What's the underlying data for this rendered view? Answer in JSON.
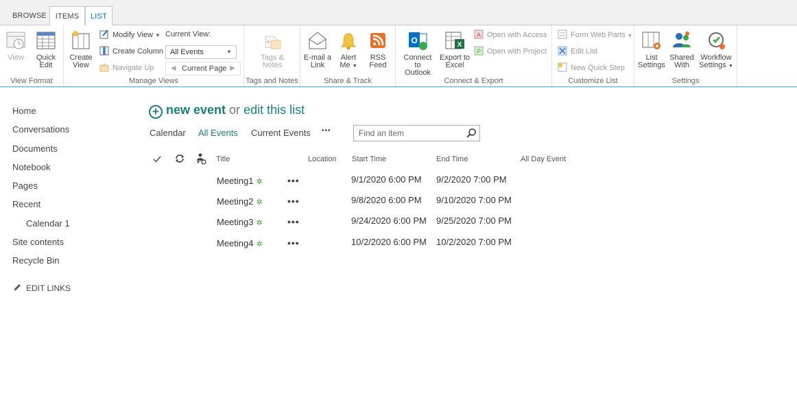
{
  "tabs": {
    "browse": "BROWSE",
    "items": "ITEMS",
    "list": "LIST"
  },
  "ribbon": {
    "view_format": {
      "label": "View Format",
      "view": "View",
      "quick_edit": [
        "Quick",
        "Edit"
      ]
    },
    "manage_views": {
      "label": "Manage Views",
      "create_view": [
        "Create",
        "View"
      ],
      "modify_view": "Modify View",
      "create_column": "Create Column",
      "navigate_up": "Navigate Up",
      "current_view_label": "Current View:",
      "current_view_value": "All Events",
      "current_page": "Current Page"
    },
    "tags_notes": {
      "label": "Tags and Notes",
      "button": [
        "Tags &",
        "Notes"
      ]
    },
    "share_track": {
      "label": "Share & Track",
      "email": [
        "E-mail a",
        "Link"
      ],
      "alert": [
        "Alert",
        "Me"
      ],
      "rss": [
        "RSS",
        "Feed"
      ]
    },
    "connect_export": {
      "label": "Connect & Export",
      "outlook": [
        "Connect to",
        "Outlook"
      ],
      "excel": [
        "Export to",
        "Excel"
      ],
      "access": "Open with Access",
      "project": "Open with Project"
    },
    "customize_list": {
      "label": "Customize List",
      "form_web_parts": "Form Web Parts",
      "edit_list": "Edit List",
      "new_quick_step": "New Quick Step"
    },
    "settings": {
      "label": "Settings",
      "list_settings": [
        "List",
        "Settings"
      ],
      "shared_with": [
        "Shared",
        "With"
      ],
      "workflow_settings": [
        "Workflow",
        "Settings"
      ]
    }
  },
  "nav": {
    "items": [
      "Home",
      "Conversations",
      "Documents",
      "Notebook",
      "Pages",
      "Recent",
      "Calendar 1",
      "Site contents",
      "Recycle Bin"
    ],
    "edit_links": "EDIT LINKS"
  },
  "main": {
    "new_event": "new event",
    "or": "or",
    "edit_list": "edit this list",
    "views": [
      "Calendar",
      "All Events",
      "Current Events"
    ],
    "more": "•••",
    "search_placeholder": "Find an item",
    "columns": [
      "Title",
      "Location",
      "Start Time",
      "End Time",
      "All Day Event"
    ],
    "rows": [
      {
        "title": "Meeting1",
        "location": "",
        "start": "9/1/2020 6:00 PM",
        "end": "9/2/2020 7:00 PM",
        "all_day": ""
      },
      {
        "title": "Meeting2",
        "location": "",
        "start": "9/8/2020 6:00 PM",
        "end": "9/10/2020 7:00 PM",
        "all_day": ""
      },
      {
        "title": "Meeting3",
        "location": "",
        "start": "9/24/2020 6:00 PM",
        "end": "9/25/2020 7:00 PM",
        "all_day": ""
      },
      {
        "title": "Meeting4",
        "location": "",
        "start": "10/2/2020 6:00 PM",
        "end": "10/2/2020 7:00 PM",
        "all_day": ""
      }
    ],
    "new_marker": "✲",
    "row_menu": "•••"
  },
  "colors": {
    "accent": "#1b7e7a",
    "ribbon_border": "#3aa9de",
    "list_tab": "#0072c6"
  }
}
